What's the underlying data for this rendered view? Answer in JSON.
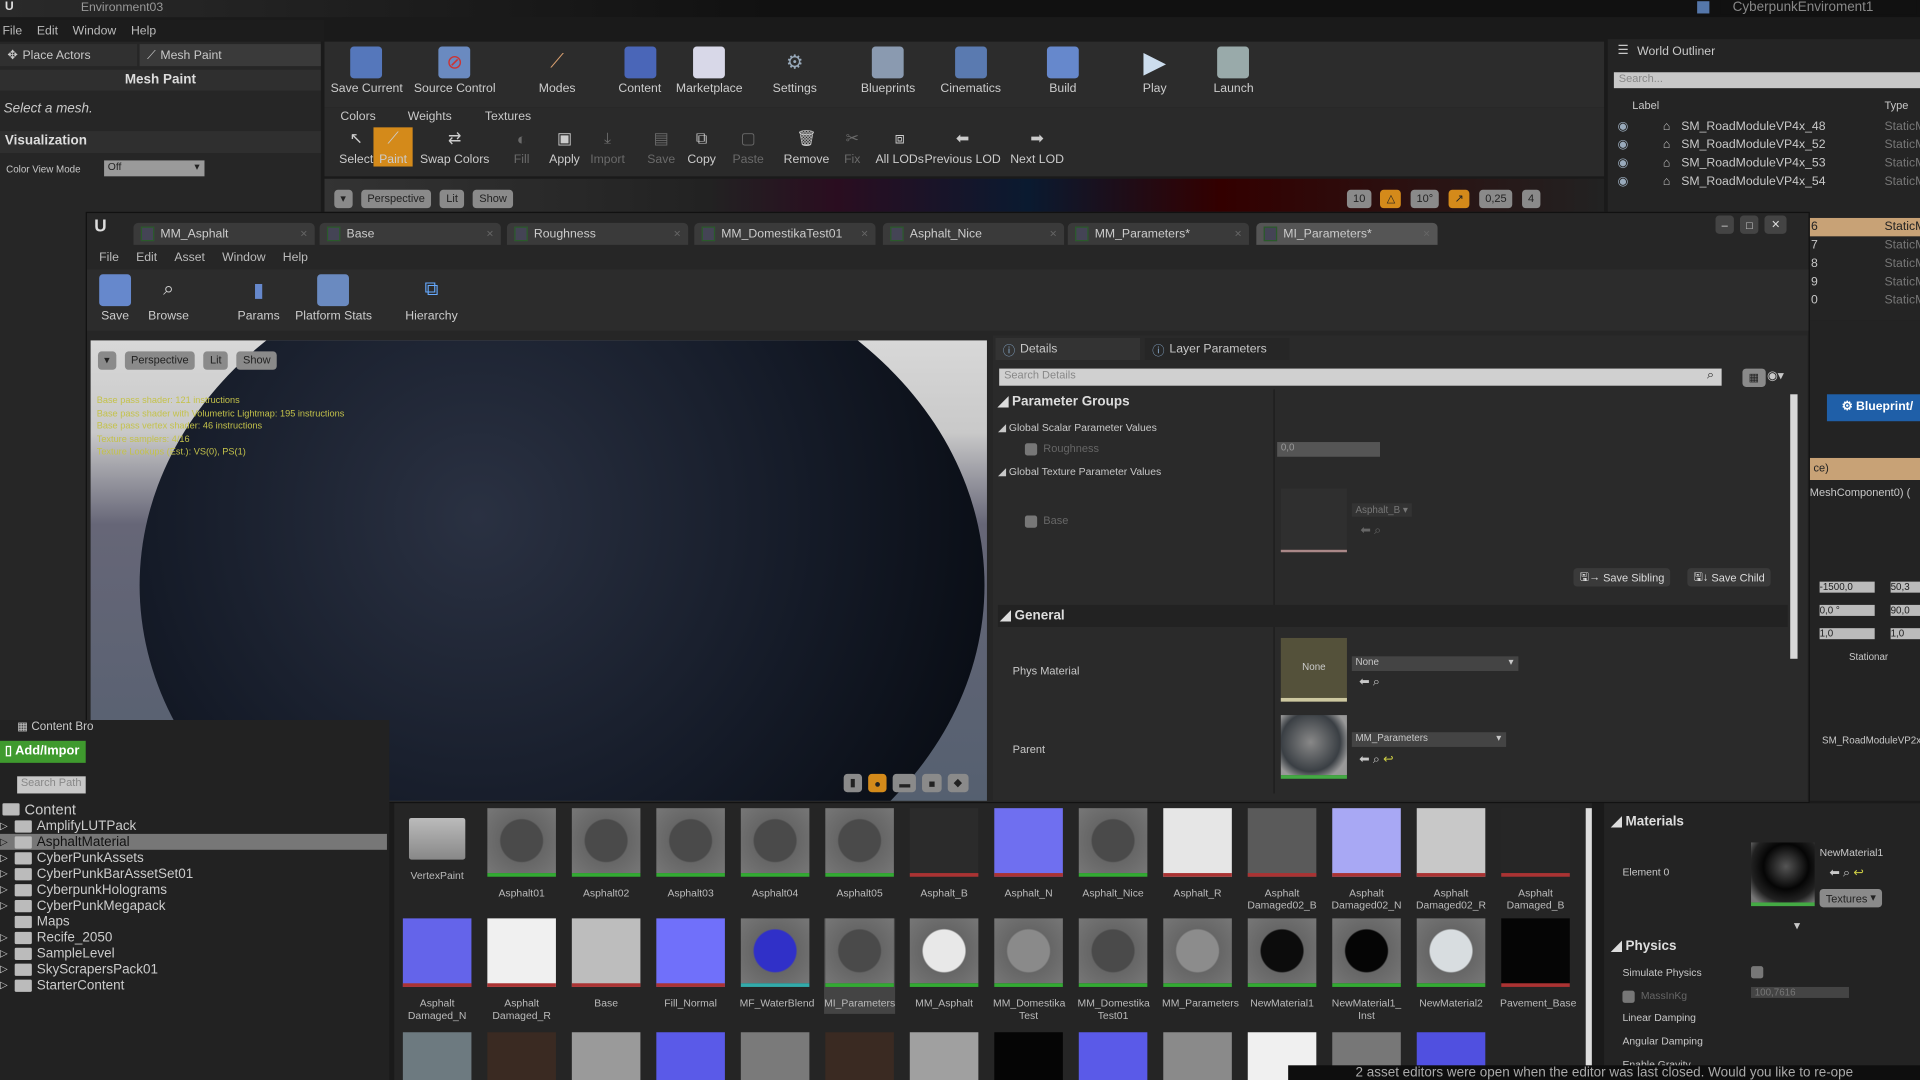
{
  "app": {
    "level_title": "Environment03",
    "project": "CyberpunkEnviroment1"
  },
  "menu": [
    "File",
    "Edit",
    "Window",
    "Help"
  ],
  "left_panel": {
    "tabs": [
      "Place Actors",
      "Mesh Paint"
    ],
    "header": "Mesh Paint",
    "hint": "Select a mesh.",
    "visualization": "Visualization",
    "color_view_mode_label": "Color View Mode",
    "color_view_mode_value": "Off"
  },
  "main_toolbar": [
    {
      "label": "Save Current",
      "icon": "save-icon"
    },
    {
      "label": "Source Control",
      "icon": "source-control-icon"
    },
    {
      "label": "Modes",
      "icon": "brush-icon"
    },
    {
      "label": "Content",
      "icon": "content-icon"
    },
    {
      "label": "Marketplace",
      "icon": "marketplace-icon"
    },
    {
      "label": "Settings",
      "icon": "gear-icon"
    },
    {
      "label": "Blueprints",
      "icon": "blueprint-icon"
    },
    {
      "label": "Cinematics",
      "icon": "clapper-icon"
    },
    {
      "label": "Build",
      "icon": "build-icon"
    },
    {
      "label": "Play",
      "icon": "play-icon"
    },
    {
      "label": "Launch",
      "icon": "launch-icon"
    }
  ],
  "paint": {
    "tabs": [
      "Colors",
      "Weights",
      "Textures"
    ],
    "tools": [
      {
        "label": "Select",
        "enabled": true
      },
      {
        "label": "Paint",
        "enabled": true,
        "active": true
      },
      {
        "label": "Swap Colors",
        "enabled": true
      },
      {
        "label": "Fill",
        "enabled": false
      },
      {
        "label": "Apply",
        "enabled": true
      },
      {
        "label": "Import",
        "enabled": false
      },
      {
        "label": "Save",
        "enabled": false
      },
      {
        "label": "Copy",
        "enabled": true
      },
      {
        "label": "Paste",
        "enabled": false
      },
      {
        "label": "Remove",
        "enabled": true
      },
      {
        "label": "Fix",
        "enabled": false
      },
      {
        "label": "All LODs",
        "enabled": true
      },
      {
        "label": "Previous LOD",
        "enabled": true
      },
      {
        "label": "Next LOD",
        "enabled": true
      }
    ]
  },
  "level_viewport": {
    "perspective": "Perspective",
    "lit": "Lit",
    "show": "Show",
    "grid": "10",
    "rotation": "10°",
    "scale": "0,25",
    "camera_speed": "4"
  },
  "outliner": {
    "title": "World Outliner",
    "search_placeholder": "Search...",
    "col_label": "Label",
    "col_type": "Type",
    "rows": [
      {
        "label": "SM_RoadModuleVP4x_48",
        "type": "StaticM"
      },
      {
        "label": "SM_RoadModuleVP4x_52",
        "type": "StaticM"
      },
      {
        "label": "SM_RoadModuleVP4x_53",
        "type": "StaticM"
      },
      {
        "label": "SM_RoadModuleVP4x_54",
        "type": "StaticM"
      },
      {
        "label": "6",
        "type": "StaticM",
        "selected": true
      },
      {
        "label": "7",
        "type": "StaticM"
      },
      {
        "label": "8",
        "type": "StaticM"
      },
      {
        "label": "9",
        "type": "StaticM"
      },
      {
        "label": "0",
        "type": "StaticM"
      }
    ]
  },
  "editor": {
    "tabs": [
      "MM_Asphalt",
      "Base",
      "Roughness",
      "MM_DomestikaTest01",
      "Asphalt_Nice",
      "MM_Parameters*",
      "MI_Parameters*"
    ],
    "menu": [
      "File",
      "Edit",
      "Asset",
      "Window",
      "Help"
    ],
    "toolbar": [
      "Save",
      "Browse",
      "Params",
      "Platform Stats",
      "Hierarchy"
    ],
    "viewport": {
      "perspective": "Perspective",
      "lit": "Lit",
      "show": "Show",
      "stats": [
        "Base pass shader: 121 instructions",
        "Base pass shader with Volumetric Lightmap: 195 instructions",
        "Base pass vertex shader: 46 instructions",
        "Texture samplers: 4/16",
        "Texture Lookups (Est.): VS(0), PS(1)"
      ]
    },
    "details": {
      "tabs": [
        "Details",
        "Layer Parameters"
      ],
      "search_placeholder": "Search Details",
      "parameter_groups": "Parameter Groups",
      "scalar_group": "Global Scalar Parameter Values",
      "roughness_label": "Roughness",
      "roughness_value": "0,0",
      "texture_group": "Global Texture Parameter Values",
      "base_label": "Base",
      "base_texture": "Asphalt_B",
      "save_sibling": "Save Sibling",
      "save_child": "Save Child",
      "general": "General",
      "phys_material_label": "Phys Material",
      "phys_material_thumb": "None",
      "phys_material_value": "None",
      "parent_label": "Parent",
      "parent_value": "MM_Parameters"
    }
  },
  "content_browser": {
    "title": "Content Bro",
    "add_import": "Add/Impor",
    "search_placeholder": "Search Path",
    "root": "Content",
    "folders": [
      "AmplifyLUTPack",
      "AsphaltMaterial",
      "CyberPunkAssets",
      "CyberPunkBarAssetSet01",
      "CyberpunkHolograms",
      "CyberPunkMegapack",
      "Maps",
      "Recife_2050",
      "SampleLevel",
      "SkyScrapersPack01",
      "StarterContent"
    ],
    "selected_folder": "AsphaltMaterial",
    "assets": [
      {
        "name": "VertexPaint",
        "kind": "folder"
      },
      {
        "name": "Asphalt01",
        "kind": "sphere"
      },
      {
        "name": "Asphalt02",
        "kind": "sphere"
      },
      {
        "name": "Asphalt03",
        "kind": "sphere"
      },
      {
        "name": "Asphalt04",
        "kind": "sphere"
      },
      {
        "name": "Asphalt05",
        "kind": "sphere"
      },
      {
        "name": "Asphalt_B",
        "kind": "texture",
        "color": "#2b2b2b"
      },
      {
        "name": "Asphalt_N",
        "kind": "texture",
        "color": "#6f6ff0"
      },
      {
        "name": "Asphalt_Nice",
        "kind": "sphere"
      },
      {
        "name": "Asphalt_R",
        "kind": "texture",
        "color": "#e6e6e6"
      },
      {
        "name": "Asphalt Damaged02_B",
        "kind": "texture",
        "color": "#5a5a5a"
      },
      {
        "name": "Asphalt Damaged02_N",
        "kind": "texture",
        "color": "#a8a8f4"
      },
      {
        "name": "Asphalt Damaged02_R",
        "kind": "texture",
        "color": "#c8c8c8"
      },
      {
        "name": "Asphalt Damaged_B",
        "kind": "texture",
        "color": "#262626"
      },
      {
        "name": "Asphalt Damaged_N",
        "kind": "texture",
        "color": "#6464ea"
      },
      {
        "name": "Asphalt Damaged_R",
        "kind": "texture",
        "color": "#f0f0f0"
      },
      {
        "name": "Base",
        "kind": "texture",
        "color": "#bdbdbd"
      },
      {
        "name": "Fill_Normal",
        "kind": "texture",
        "color": "#7070fa"
      },
      {
        "name": "MF_WaterBlend",
        "kind": "sphere",
        "color": "#3030c8"
      },
      {
        "name": "MI_Parameters",
        "kind": "sphere",
        "selected": true
      },
      {
        "name": "MM_Asphalt",
        "kind": "sphere",
        "color": "#e8e8e8"
      },
      {
        "name": "MM_Domestika Test",
        "kind": "sphere",
        "color": "#8a8a8a"
      },
      {
        "name": "MM_Domestika Test01",
        "kind": "sphere"
      },
      {
        "name": "MM_Parameters",
        "kind": "sphere",
        "color": "#8c8c8c"
      },
      {
        "name": "NewMaterial1",
        "kind": "sphere",
        "color": "#0c0c0c"
      },
      {
        "name": "NewMaterial1_ Inst",
        "kind": "sphere",
        "color": "#050505"
      },
      {
        "name": "NewMaterial2",
        "kind": "sphere",
        "color": "#d8dde0"
      },
      {
        "name": "Pavement_Base",
        "kind": "texture",
        "color": "#050505"
      }
    ],
    "row3_colors": [
      "#6d7a80",
      "#3a2a22",
      "#9a9a9a",
      "#5a5ae8",
      "#7a7a7a",
      "#3a2a22",
      "#a0a0a0",
      "#050505",
      "#5a5ae8",
      "#8a8a8a",
      "#f0f0f0",
      "#777",
      "#5050e0"
    ]
  },
  "right_details": {
    "blueprint_button": "Blueprint/",
    "component_suffix": "ce)",
    "mesh_component": "MeshComponent0) (",
    "loc_y": "-1500,0",
    "loc_z": "50,3",
    "rot_y": "0,0 °",
    "rot_z": "90,0",
    "scale_y": "1,0",
    "scale_z": "1,0",
    "mobility": "Stationar",
    "mesh_name": "SM_RoadModuleVP2x",
    "materials_header": "Materials",
    "element_label": "Element 0",
    "element_value": "NewMaterial1",
    "textures_button": "Textures",
    "physics_header": "Physics",
    "physics_rows": [
      "Simulate Physics",
      "MassInKg",
      "Linear Damping",
      "Angular Damping",
      "Enable Gravity"
    ],
    "mass_value": "100,7616"
  },
  "notification": "2 asset editors were open when the editor was last closed. Would you like to re-ope",
  "colors": {
    "accent_orange": "#d48a1a",
    "add_import_green": "#3f9a2e",
    "blueprint_blue": "#1f5fa8",
    "selected_row": "#c8a276"
  }
}
